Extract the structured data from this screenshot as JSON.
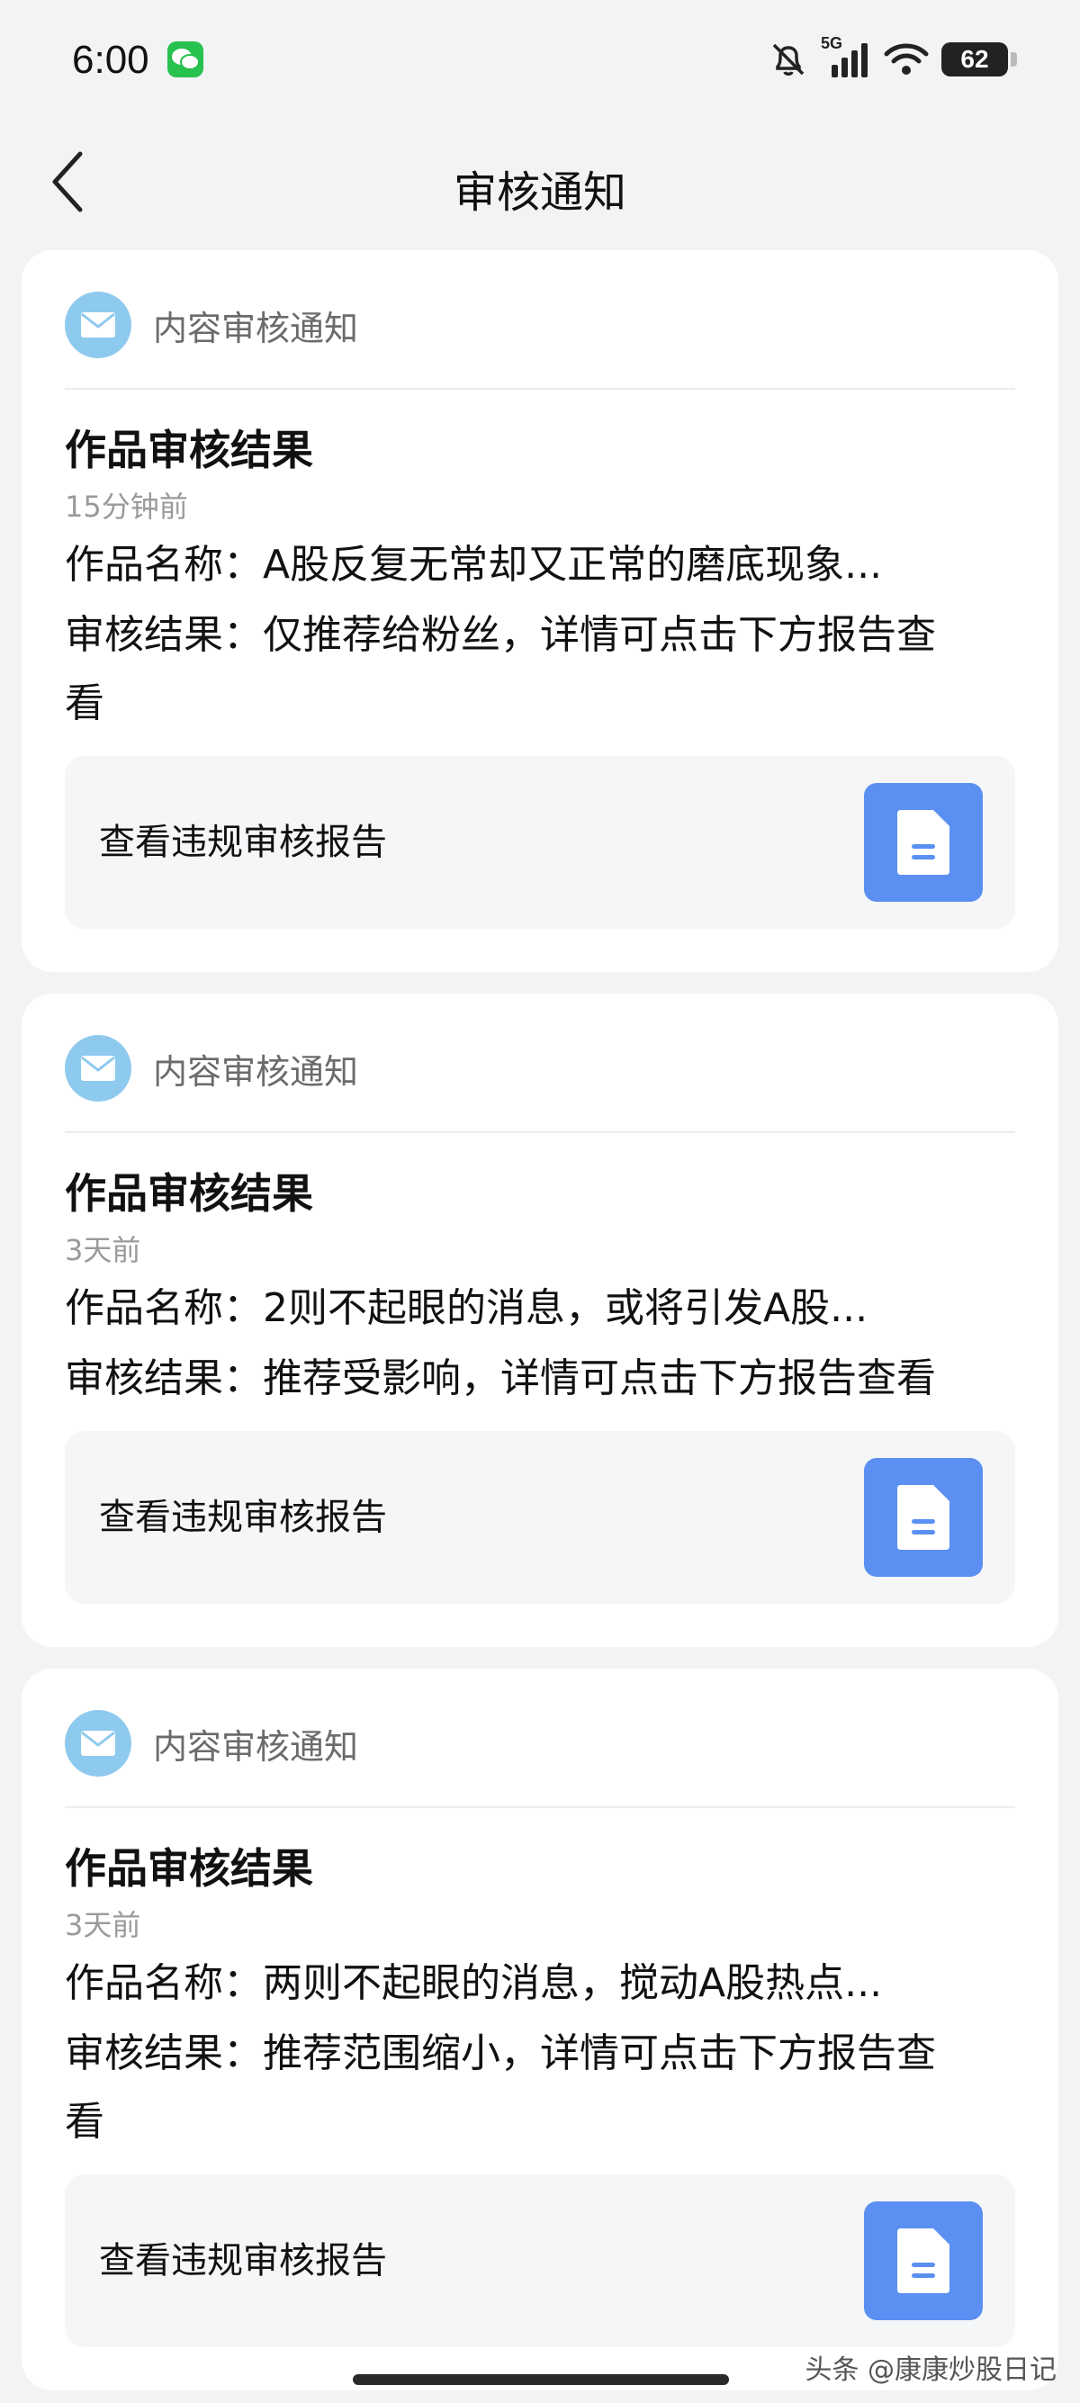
{
  "status_bar": {
    "time": "6:00",
    "network": "5G",
    "battery": "62",
    "icons": [
      "wechat-icon",
      "mute-icon",
      "signal-icon",
      "wifi-icon",
      "battery-icon"
    ]
  },
  "header": {
    "title": "审核通知",
    "back_icon": "chevron-left-icon"
  },
  "cards": [
    {
      "source": "内容审核通知",
      "title": "作品审核结果",
      "time": "15分钟前",
      "work_name": "作品名称：A股反复无常却又正常的磨底现象...",
      "result_line1": "审核结果：仅推荐给粉丝，详情可点击下方报告查",
      "result_line2": "看",
      "report_label": "查看违规审核报告"
    },
    {
      "source": "内容审核通知",
      "title": "作品审核结果",
      "time": "3天前",
      "work_name": "作品名称：2则不起眼的消息，或将引发A股...",
      "result_line1": "审核结果：推荐受影响，详情可点击下方报告查看",
      "result_line2": "",
      "report_label": "查看违规审核报告"
    },
    {
      "source": "内容审核通知",
      "title": "作品审核结果",
      "time": "3天前",
      "work_name": "作品名称：两则不起眼的消息，搅动A股热点...",
      "result_line1": "审核结果：推荐范围缩小，详情可点击下方报告查",
      "result_line2": "看",
      "report_label": "查看违规审核报告"
    }
  ],
  "watermark": "头条 @康康炒股日记",
  "colors": {
    "background": "#f2f3f5",
    "card": "#ffffff",
    "mail_icon": "#8ec9ee",
    "report_button": "#5b8ff2",
    "wechat": "#27c14f"
  }
}
